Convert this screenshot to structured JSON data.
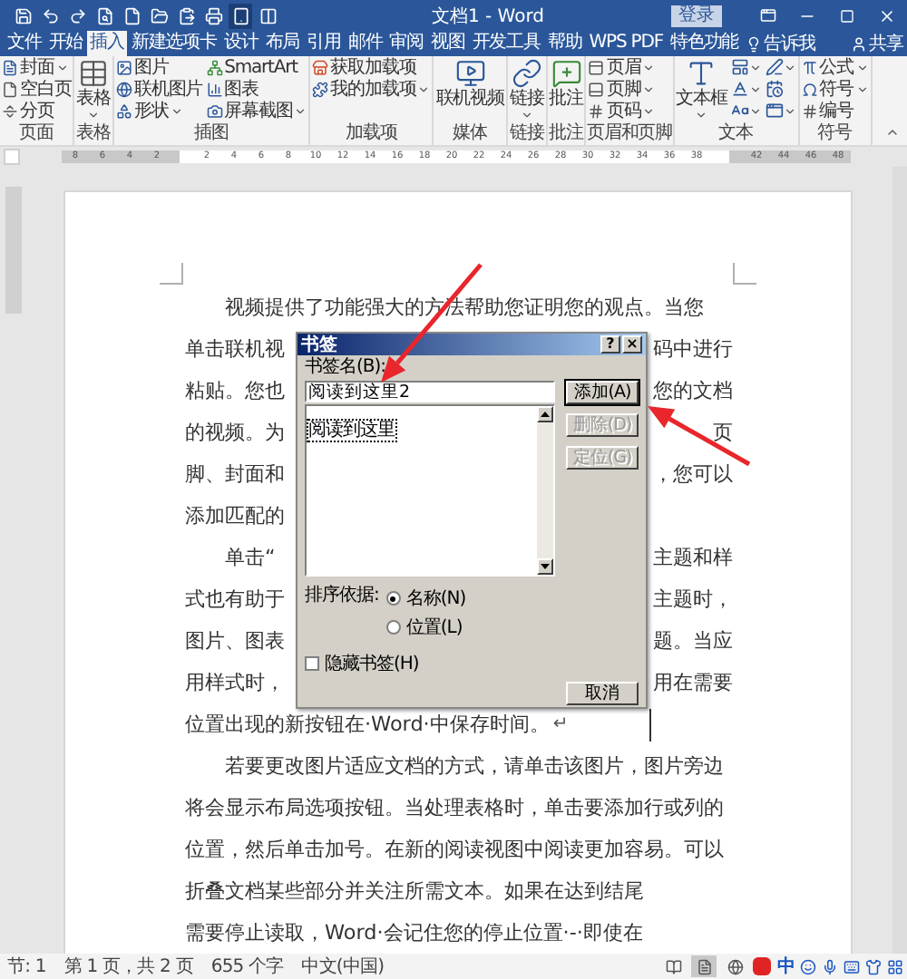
{
  "title_bar": {
    "title": "文档1 - Word",
    "sign_in": "登录"
  },
  "tabs": [
    {
      "label": "文件",
      "selected": false
    },
    {
      "label": "开始",
      "selected": false
    },
    {
      "label": "插入",
      "selected": true
    },
    {
      "label": "新建选项卡",
      "selected": false
    },
    {
      "label": "设计",
      "selected": false
    },
    {
      "label": "布局",
      "selected": false
    },
    {
      "label": "引用",
      "selected": false
    },
    {
      "label": "邮件",
      "selected": false
    },
    {
      "label": "审阅",
      "selected": false
    },
    {
      "label": "视图",
      "selected": false
    },
    {
      "label": "开发工具",
      "selected": false
    },
    {
      "label": "帮助",
      "selected": false
    },
    {
      "label": "WPS PDF",
      "selected": false
    },
    {
      "label": "特色功能",
      "selected": false
    }
  ],
  "tell_me": "告诉我",
  "share": "共享",
  "ribbon_groups": [
    {
      "label": "页面",
      "columns": [
        [
          {
            "kind": "small",
            "label": "封面",
            "dropdown": true
          },
          {
            "kind": "small",
            "label": "空白页",
            "dropdown": false
          },
          {
            "kind": "small",
            "label": "分页",
            "dropdown": false
          }
        ]
      ]
    },
    {
      "label": "表格",
      "columns": [
        [
          {
            "kind": "large",
            "label": "表格",
            "dropdown": true
          }
        ]
      ]
    },
    {
      "label": "插图",
      "columns": [
        [
          {
            "kind": "small",
            "label": "图片",
            "dropdown": false
          },
          {
            "kind": "small",
            "label": "联机图片",
            "dropdown": false
          },
          {
            "kind": "small",
            "label": "形状",
            "dropdown": true
          }
        ],
        [
          {
            "kind": "small",
            "label": "SmartArt",
            "dropdown": false
          },
          {
            "kind": "small",
            "label": "图表",
            "dropdown": false
          },
          {
            "kind": "small",
            "label": "屏幕截图",
            "dropdown": true
          }
        ]
      ]
    },
    {
      "label": "加载项",
      "columns": [
        [
          {
            "kind": "small",
            "label": "获取加载项",
            "dropdown": false
          },
          {
            "kind": "small",
            "label": "我的加载项",
            "dropdown": true
          }
        ]
      ]
    },
    {
      "label": "媒体",
      "columns": [
        [
          {
            "kind": "large",
            "label": "联机视频",
            "dropdown": false
          }
        ]
      ]
    },
    {
      "label": "链接",
      "columns": [
        [
          {
            "kind": "large",
            "label": "链接",
            "dropdown": true
          }
        ]
      ]
    },
    {
      "label": "批注",
      "columns": [
        [
          {
            "kind": "large",
            "label": "批注",
            "dropdown": false
          }
        ]
      ]
    },
    {
      "label": "页眉和页脚",
      "columns": [
        [
          {
            "kind": "small",
            "label": "页眉",
            "dropdown": true
          },
          {
            "kind": "small",
            "label": "页脚",
            "dropdown": true
          },
          {
            "kind": "small",
            "label": "页码",
            "dropdown": true
          }
        ]
      ]
    },
    {
      "label": "文本",
      "columns": [
        [
          {
            "kind": "large",
            "label": "文本框",
            "dropdown": true
          }
        ],
        [
          {
            "kind": "icon",
            "dropdown": true
          },
          {
            "kind": "icon",
            "dropdown": true
          },
          {
            "kind": "icon",
            "dropdown": true
          }
        ],
        [
          {
            "kind": "icon",
            "dropdown": true
          },
          {
            "kind": "icon",
            "dropdown": false
          },
          {
            "kind": "icon",
            "dropdown": true
          }
        ]
      ]
    },
    {
      "label": "符号",
      "columns": [
        [
          {
            "kind": "small",
            "label": "公式",
            "dropdown": true
          },
          {
            "kind": "small",
            "label": "符号",
            "dropdown": true
          },
          {
            "kind": "small",
            "label": "编号",
            "dropdown": false
          }
        ]
      ]
    }
  ],
  "ruler": {
    "left_numbers": [
      "8",
      "6",
      "4",
      "2"
    ],
    "numbers": [
      "2",
      "4",
      "6",
      "8",
      "10",
      "12",
      "14",
      "16",
      "18",
      "20",
      "22",
      "24",
      "26",
      "28",
      "30",
      "32",
      "34",
      "36",
      "38"
    ],
    "right_numbers": [
      "42",
      "44",
      "46",
      "48"
    ]
  },
  "document": {
    "lines": [
      {
        "left": "视频提供了功能强大的方法帮助您证明您的观点。当您",
        "indent": true
      },
      {
        "left": "单击联机视",
        "right": "码中进行",
        "indent": false
      },
      {
        "left": "粘贴。您也",
        "right": "您的文档",
        "indent": false
      },
      {
        "left": "的视频。为",
        "right": "页",
        "indent": false
      },
      {
        "left": "脚、封面和",
        "right": "，您可以",
        "indent": false
      },
      {
        "left": "添加匹配的",
        "indent": false
      },
      {
        "left": "单击“",
        "right": "主题和样",
        "indent": true
      },
      {
        "left": "式也有助于",
        "right": "主题时，",
        "indent": false
      },
      {
        "left": "图片、图表",
        "right": "题。当应",
        "indent": false
      },
      {
        "left": "用样式时，",
        "right": "用在需要",
        "indent": false
      },
      {
        "left": "位置出现的新按钮在·Word·中保存时间。",
        "mark": "↵",
        "indent": false
      },
      {
        "left": "若要更改图片适应文档的方式，请单击该图片，图片旁边",
        "indent": true
      },
      {
        "left": "将会显示布局选项按钮。当处理表格时，单击要添加行或列的",
        "indent": false
      },
      {
        "left": "位置，然后单击加号。在新的阅读视图中阅读更加容易。可以",
        "indent": false
      },
      {
        "left": "折叠文档某些部分并关注所需文本。如果在达到结尾",
        "indent": false
      },
      {
        "left": "需要停止读取，Word·会记住您的停止位置·-·即使在",
        "indent": false
      }
    ]
  },
  "dialog": {
    "title": "书签",
    "help": "?",
    "close": "×",
    "name_label": "书签名(B):",
    "name_value": "阅读到这里2",
    "list": [
      {
        "label": "阅读到这里",
        "focused": true
      }
    ],
    "buttons": [
      {
        "label": "添加(A)",
        "disabled": false,
        "default": true
      },
      {
        "label": "删除(D)",
        "disabled": true,
        "default": false
      },
      {
        "label": "定位(G)",
        "disabled": true,
        "default": false
      }
    ],
    "sort_label": "排序依据:",
    "sort_options": [
      {
        "label": "名称(N)",
        "selected": true
      },
      {
        "label": "位置(L)",
        "selected": false
      }
    ],
    "hidden_checkbox": {
      "label": "隐藏书签(H)",
      "checked": false
    },
    "cancel": "取消"
  },
  "status_bar": {
    "items": [
      "节: 1",
      "第 1 页，共 2 页",
      "655 个字",
      "中文(中国)"
    ],
    "ime": "中"
  }
}
